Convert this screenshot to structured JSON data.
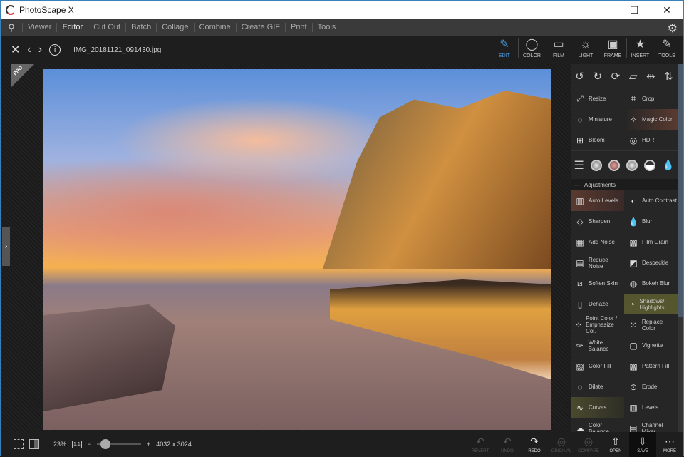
{
  "window": {
    "title": "PhotoScape X",
    "controls": [
      "—",
      "☐",
      "✕"
    ]
  },
  "menu": {
    "items": [
      "Viewer",
      "Editor",
      "Cut Out",
      "Batch",
      "Collage",
      "Combine",
      "Create GIF",
      "Print",
      "Tools"
    ],
    "active": "Editor"
  },
  "toolbar": {
    "filename": "IMG_20181121_091430.jpg",
    "tabs": [
      {
        "label": "EDIT",
        "icon": "✎"
      },
      {
        "label": "COLOR",
        "icon": "◯"
      },
      {
        "label": "FILM",
        "icon": "▭"
      },
      {
        "label": "LIGHT",
        "icon": "☼"
      },
      {
        "label": "FRAME",
        "icon": "▣"
      },
      {
        "label": "INSERT",
        "icon": "★"
      },
      {
        "label": "TOOLS",
        "icon": "✎"
      }
    ]
  },
  "canvas": {
    "pro_badge": "PRO",
    "expand_icon": "›"
  },
  "panel": {
    "rotate_icons": [
      "↺",
      "↻",
      "⟳",
      "▱",
      "⇹",
      "⇅"
    ],
    "tools": [
      {
        "label": "Resize",
        "icon": "⤢"
      },
      {
        "label": "Crop",
        "icon": "⌗"
      },
      {
        "label": "Miniature",
        "icon": "◌"
      },
      {
        "label": "Magic Color",
        "icon": "✧"
      },
      {
        "label": "Bloom",
        "icon": "⊞"
      },
      {
        "label": "HDR",
        "icon": "◎"
      }
    ],
    "section_title": "Adjustments",
    "adjustments": [
      {
        "label": "Auto Levels",
        "icon": "▥"
      },
      {
        "label": "Auto Contrast",
        "icon": "◐"
      },
      {
        "label": "Sharpen",
        "icon": "◇"
      },
      {
        "label": "Blur",
        "icon": "💧"
      },
      {
        "label": "Add Noise",
        "icon": "▦"
      },
      {
        "label": "Film Grain",
        "icon": "▩"
      },
      {
        "label": "Reduce Noise",
        "icon": "▤"
      },
      {
        "label": "Despeckle",
        "icon": "◩"
      },
      {
        "label": "Soften Skin",
        "icon": "⧄"
      },
      {
        "label": "Bokeh Blur",
        "icon": "◍"
      },
      {
        "label": "Dehaze",
        "icon": "▯"
      },
      {
        "label": "Shadows/ Highlights",
        "icon": "◔"
      },
      {
        "label": "Point Color / Emphasize Col.",
        "icon": "⁘"
      },
      {
        "label": "Replace Color",
        "icon": "⁙"
      },
      {
        "label": "White Balance",
        "icon": "✑"
      },
      {
        "label": "Vignette",
        "icon": "▢"
      },
      {
        "label": "Color Fill",
        "icon": "▨"
      },
      {
        "label": "Pattern Fill",
        "icon": "▩"
      },
      {
        "label": "Dilate",
        "icon": "◌"
      },
      {
        "label": "Erode",
        "icon": "⊙"
      },
      {
        "label": "Curves",
        "icon": "∿"
      },
      {
        "label": "Levels",
        "icon": "▥"
      },
      {
        "label": "Color Balance",
        "icon": "☁"
      },
      {
        "label": "Channel Mixer",
        "icon": "▤"
      }
    ]
  },
  "bottom": {
    "zoom": "23%",
    "one_to_one": "1:1",
    "dimensions": "4032 x 3024",
    "zoom_slider_fraction": 0.1,
    "buttons": [
      {
        "label": "REVERT",
        "icon": "↶"
      },
      {
        "label": "UNDO",
        "icon": "↶"
      },
      {
        "label": "REDO",
        "icon": "↷"
      },
      {
        "label": "ORIGINAL",
        "icon": "◎"
      },
      {
        "label": "COMPARE",
        "icon": "◎"
      },
      {
        "label": "OPEN",
        "icon": "⇧"
      },
      {
        "label": "SAVE",
        "icon": "⇩"
      },
      {
        "label": "MORE",
        "icon": "⋯"
      }
    ]
  }
}
